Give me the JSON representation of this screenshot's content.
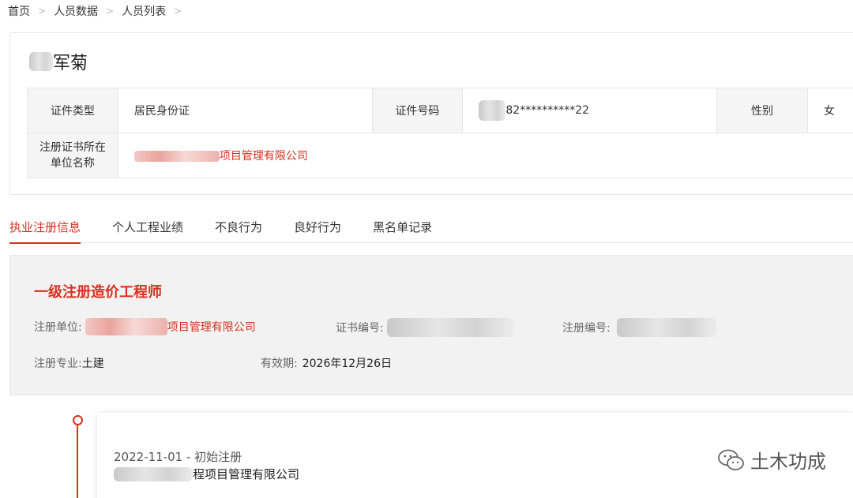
{
  "breadcrumb": {
    "home": "首页",
    "level2": "人员数据",
    "level3": "人员列表"
  },
  "person": {
    "name_visible": "军菊",
    "info": {
      "id_type_label": "证件类型",
      "id_type_value": "居民身份证",
      "id_no_label": "证件号码",
      "id_no_value": "82**********22",
      "gender_label": "性别",
      "gender_value": "女",
      "unit_label": "注册证书所在单位名称",
      "unit_value": "项目管理有限公司"
    }
  },
  "tabs": [
    {
      "label": "执业注册信息",
      "active": true
    },
    {
      "label": "个人工程业绩",
      "active": false
    },
    {
      "label": "不良行为",
      "active": false
    },
    {
      "label": "良好行为",
      "active": false
    },
    {
      "label": "黑名单记录",
      "active": false
    }
  ],
  "registration": {
    "title": "一级注册造价工程师",
    "unit_label": "注册单位:",
    "unit_value": "项目管理有限公司",
    "cert_no_label": "证书编号:",
    "reg_no_label": "注册编号:",
    "major_label": "注册专业:",
    "major_value": "土建",
    "valid_label": "有效期:",
    "valid_value": "2026年12月26日"
  },
  "timeline": [
    {
      "date_event": "2022-11-01 - 初始注册",
      "company": "程项目管理有限公司"
    }
  ],
  "watermark": {
    "text": "土木功成",
    "icon": "wechat-icon"
  },
  "colors": {
    "accent": "#d9301e",
    "panel_bg": "#f2f2f2",
    "label_bg": "#f5f5f5"
  }
}
